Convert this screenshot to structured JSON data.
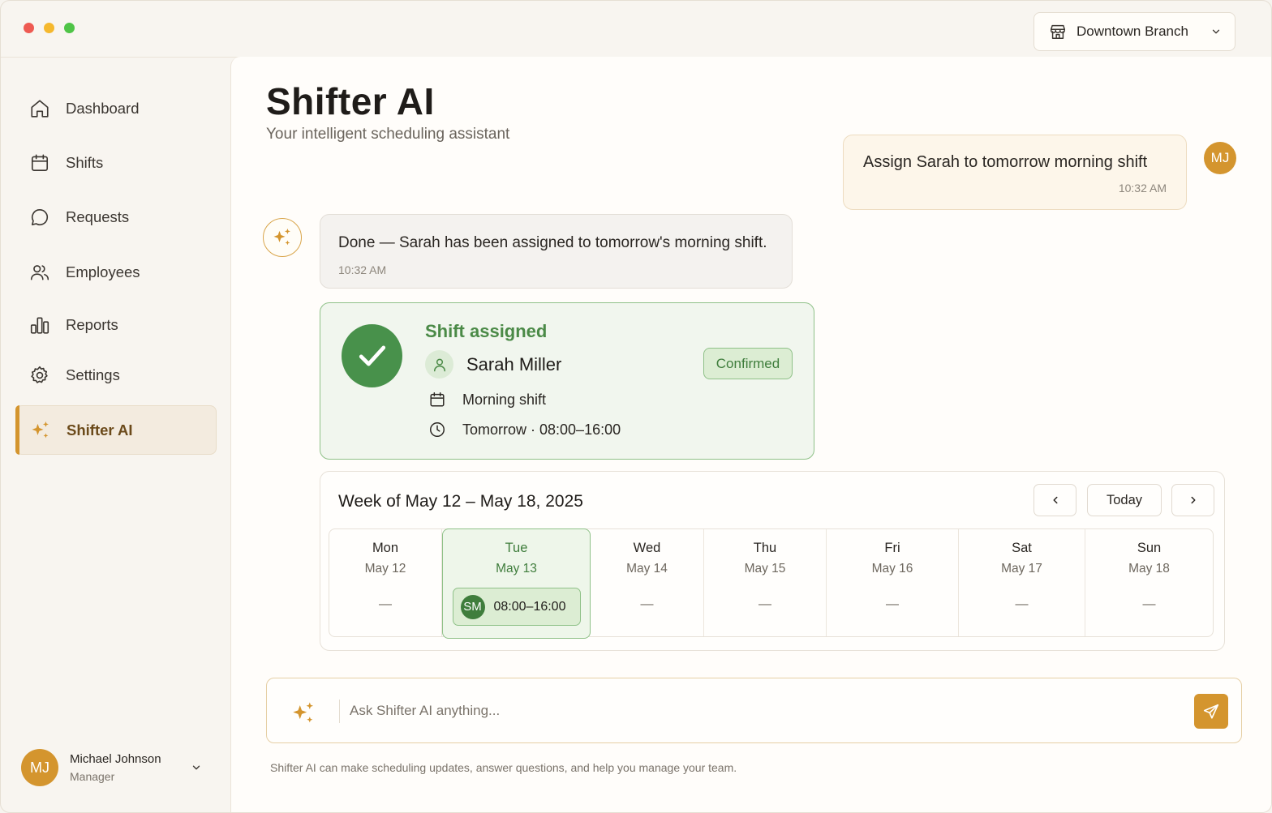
{
  "app": {
    "branch_selector": {
      "label": "Downtown Branch"
    }
  },
  "sidebar": {
    "items": [
      {
        "label": "Dashboard",
        "icon": "home-icon"
      },
      {
        "label": "Shifts",
        "icon": "calendar-icon"
      },
      {
        "label": "Requests",
        "icon": "chat-bubble-icon"
      },
      {
        "label": "Employees",
        "icon": "users-icon"
      },
      {
        "label": "Reports",
        "icon": "bar-chart-icon"
      },
      {
        "label": "Settings",
        "icon": "gear-icon"
      },
      {
        "label": "Shifter AI",
        "icon": "sparkle-icon",
        "active": true
      }
    ],
    "user": {
      "initials": "MJ",
      "name": "Michael Johnson",
      "role": "Manager"
    }
  },
  "main": {
    "title": "Shifter AI",
    "subtitle": "Your intelligent scheduling assistant",
    "messages": [
      {
        "from": "user",
        "initials": "MJ",
        "text": "Assign Sarah to tomorrow morning shift",
        "time": "10:32 AM"
      },
      {
        "from": "ai",
        "text": "Done — Sarah has been assigned to tomorrow's morning shift.",
        "time": "10:32 AM"
      }
    ],
    "shift_card": {
      "title": "Shift assigned",
      "employee": "Sarah Miller",
      "status": "Confirmed",
      "shift_type": "Morning shift",
      "when": "Tomorrow · 08:00–16:00"
    },
    "week": {
      "title": "Week of May 12 – May 18, 2025",
      "today_label": "Today",
      "days": [
        {
          "name": "Mon",
          "date": "May 12",
          "empty": "—"
        },
        {
          "name": "Tue",
          "date": "May 13",
          "today": true,
          "shift": {
            "initials": "SM",
            "time": "08:00–16:00"
          }
        },
        {
          "name": "Wed",
          "date": "May 14",
          "empty": "—"
        },
        {
          "name": "Thu",
          "date": "May 15",
          "empty": "—"
        },
        {
          "name": "Fri",
          "date": "May 16",
          "empty": "—"
        },
        {
          "name": "Sat",
          "date": "May 17",
          "empty": "—"
        },
        {
          "name": "Sun",
          "date": "May 18",
          "empty": "—"
        }
      ]
    },
    "composer": {
      "placeholder": "Ask Shifter AI anything...",
      "value": ""
    },
    "footnote": "Shifter AI can make scheduling updates, answer questions, and help you manage your team."
  },
  "colors": {
    "accent": "#d4952e",
    "success": "#48914b",
    "success_light": "#dcedd3",
    "background": "#f8f5f0"
  }
}
